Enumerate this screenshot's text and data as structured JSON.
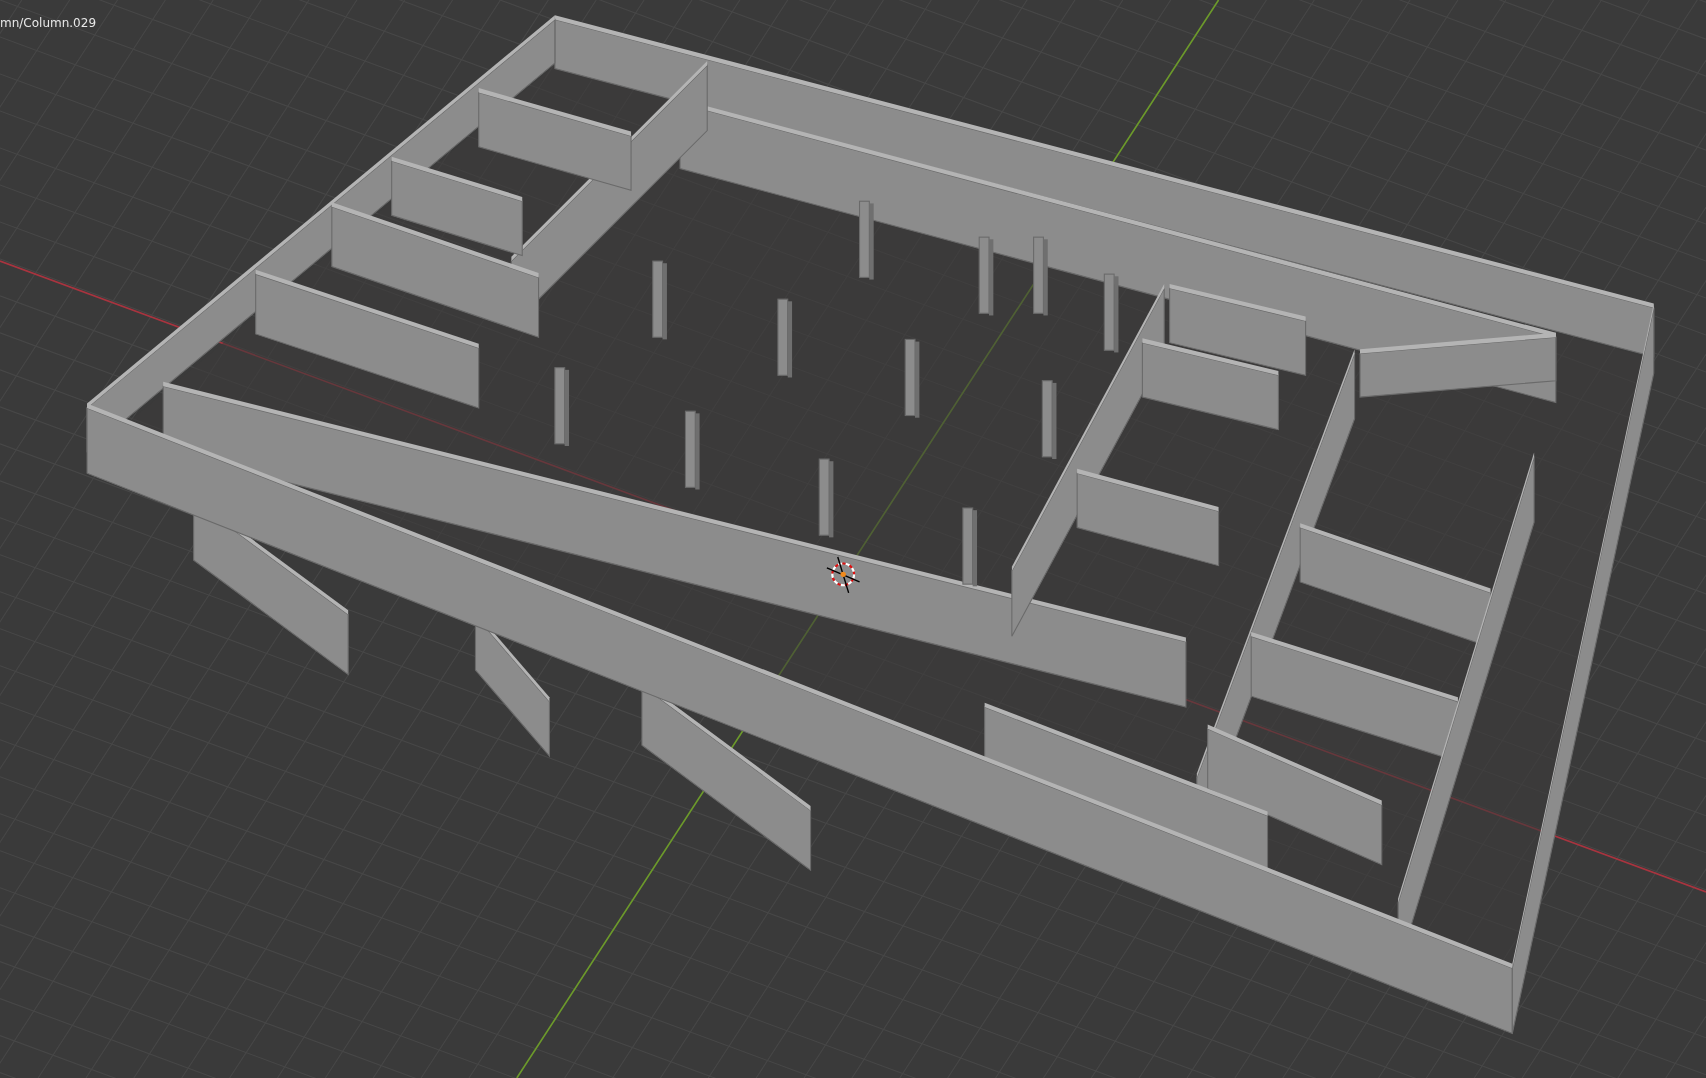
{
  "viewport": {
    "object_label": "mn/Column.029"
  }
}
